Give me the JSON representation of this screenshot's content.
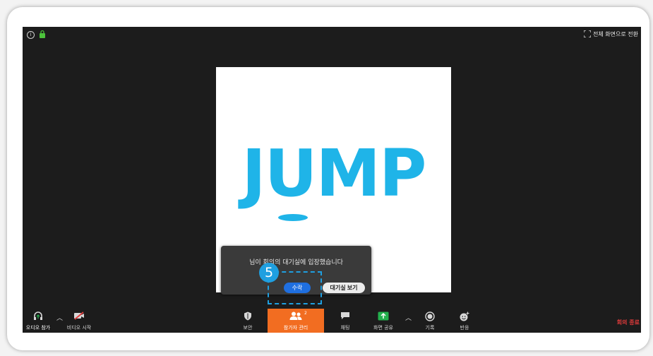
{
  "topbar": {
    "fullscreen_label": "전체 화면으로 전환"
  },
  "shared_screen": {
    "logo_text": "JUMP"
  },
  "notification": {
    "message": "님이 회의의 대기실에 입장했습니다",
    "accept_label": "수락",
    "view_waiting_room_label": "대기실 보기"
  },
  "tutorial": {
    "step_number": "5"
  },
  "toolbar": {
    "join_audio_label": "오디오 참가",
    "start_video_label": "비디오 시작",
    "security_label": "보안",
    "participants_label": "참가자 관리",
    "participants_count": "2",
    "chat_label": "채팅",
    "share_screen_label": "화면 공유",
    "record_label": "기록",
    "reactions_label": "반응",
    "end_meeting_label": "회의 종료"
  },
  "colors": {
    "accent_blue": "#1f6fe0",
    "logo_blue": "#1fb4e8",
    "participants_orange": "#f26d21",
    "share_green": "#23b14d",
    "end_red": "#e03b3b",
    "lock_green": "#4cc23b"
  },
  "icons": {
    "info": "info-icon",
    "lock": "lock-icon",
    "fullscreen": "fullscreen-icon",
    "headphone": "headphone-icon",
    "video_off": "video-off-icon",
    "shield": "shield-icon",
    "participants": "participants-icon",
    "chat": "chat-bubble-icon",
    "share": "share-screen-icon",
    "record": "record-icon",
    "reaction": "reaction-icon"
  }
}
